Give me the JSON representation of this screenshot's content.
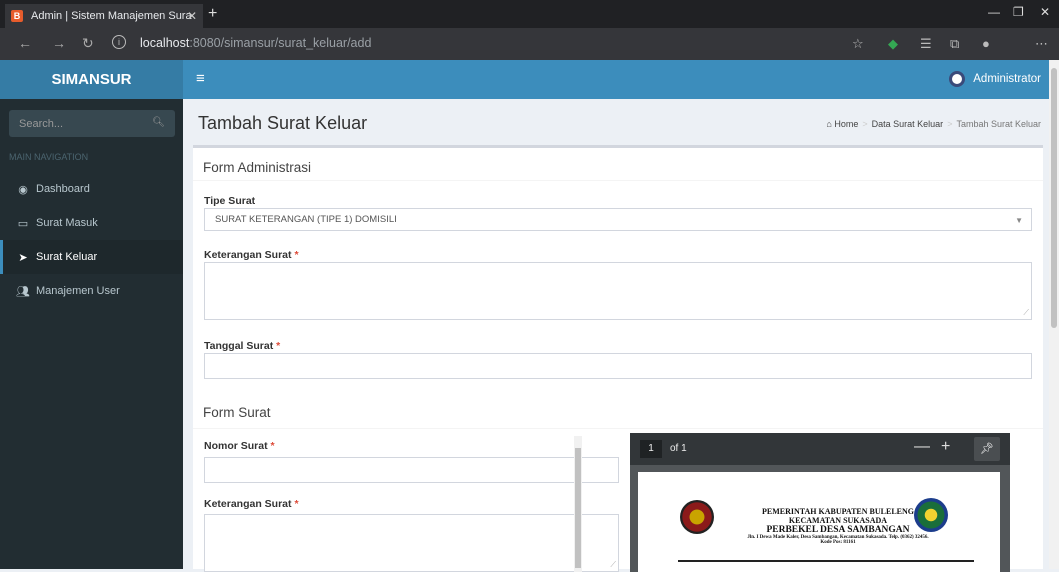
{
  "browser": {
    "tab_title": "Admin | Sistem Manajemen Sura",
    "favicon_letter": "B",
    "url_host": "localhost",
    "url_path": ":8080/simansur/surat_keluar/add"
  },
  "app": {
    "logo": "SIMANSUR",
    "user_name": "Administrator"
  },
  "sidebar": {
    "search_placeholder": "Search...",
    "nav_header": "MAIN NAVIGATION",
    "items": [
      {
        "label": "Dashboard",
        "icon": "dashboard-icon"
      },
      {
        "label": "Surat Masuk",
        "icon": "inbox-icon"
      },
      {
        "label": "Surat Keluar",
        "icon": "send-icon",
        "active": true
      },
      {
        "label": "Manajemen User",
        "icon": "users-icon"
      }
    ]
  },
  "page": {
    "title": "Tambah Surat Keluar",
    "breadcrumb": [
      "Home",
      "Data Surat Keluar",
      "Tambah Surat Keluar"
    ]
  },
  "form_admin": {
    "title": "Form Administrasi",
    "tipe_label": "Tipe Surat",
    "tipe_value": "SURAT KETERANGAN (TIPE 1) DOMISILI",
    "keterangan_label": "Keterangan Surat",
    "keterangan_value": "",
    "tanggal_label": "Tanggal Surat",
    "tanggal_value": ""
  },
  "form_surat": {
    "title": "Form Surat",
    "nomor_label": "Nomor Surat",
    "nomor_value": "",
    "keterangan_label": "Keterangan Surat",
    "keterangan_value": "",
    "required_mark": "*"
  },
  "pdf_viewer": {
    "page_number": "1",
    "page_total": "of 1",
    "letterhead": {
      "line1": "PEMERINTAH KABUPATEN BULELENG",
      "line2": "KECAMATAN SUKASADA",
      "line3": "PERBEKEL DESA SAMBANGAN",
      "line4": "Jln. I Dewa Made Kaler, Desa Sambangan, Kecamatan Sukasada. Telp. (0362) 32456. Kode Pos: 81161"
    }
  },
  "colors": {
    "navbar": "#3c8dbc",
    "logo_bg": "#357ca5",
    "sidebar": "#222d32",
    "required": "#dd4b39"
  }
}
